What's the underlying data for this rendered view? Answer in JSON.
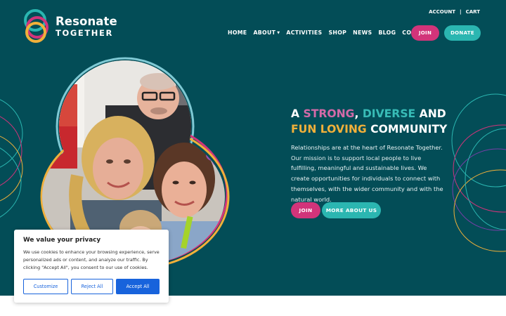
{
  "brand": {
    "line1": "Resonate",
    "line2": "TOGETHER",
    "colors": {
      "teal": "#2bb6b1",
      "pink": "#d2347a",
      "yellow": "#f1b03a",
      "background": "#034d57"
    }
  },
  "utility_nav": {
    "account": "ACCOUNT",
    "separator": "|",
    "cart": "CART"
  },
  "main_nav": {
    "items": [
      {
        "label": "HOME"
      },
      {
        "label": "ABOUT",
        "has_dropdown": true
      },
      {
        "label": "ACTIVITIES"
      },
      {
        "label": "SHOP"
      },
      {
        "label": "NEWS"
      },
      {
        "label": "BLOG"
      },
      {
        "label": "CONTACT"
      }
    ],
    "join": "JOIN",
    "donate": "DONATE"
  },
  "hero": {
    "heading": {
      "a": "A ",
      "strong": "STRONG",
      "comma": ", ",
      "diverse": "DIVERSE",
      "and": " AND",
      "fun_loving": "FUN LOVING",
      "community": " COMMUNITY"
    },
    "paragraph": "Relationships are at the heart of Resonate Together. Our mission is to support local people to live fulfilling, meaningful and sustainable lives. We create opportunities for individuals to connect with themselves, with the wider community and with the natural world.",
    "join_button": "JOIN",
    "more_button": "MORE ABOUT US"
  },
  "cookie_banner": {
    "title": "We value your privacy",
    "text": "We use cookies to enhance your browsing experience, serve personalized ads or content, and analyze our traffic. By clicking \"Accept All\", you consent to our use of cookies.",
    "customize": "Customize",
    "reject": "Reject All",
    "accept": "Accept All"
  }
}
